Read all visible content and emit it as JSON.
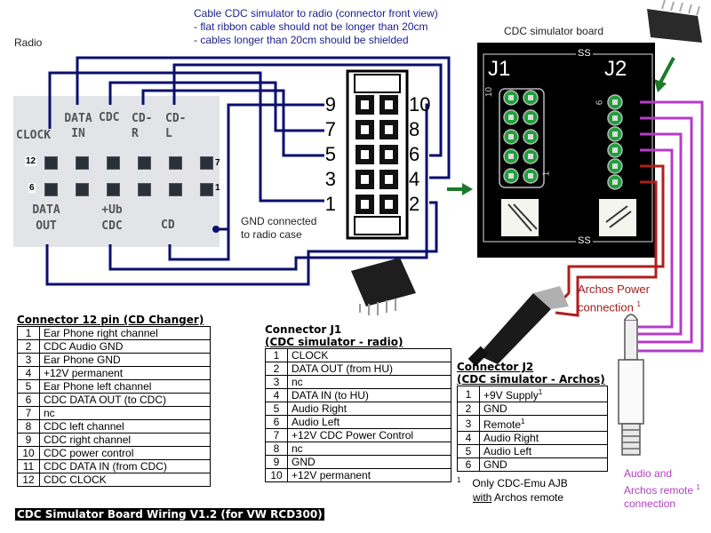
{
  "labels": {
    "radio": "Radio",
    "cable_note_lines": [
      "Cable CDC simulator to radio (connector front view)",
      "- flat ribbon cable should not be longer than 20cm",
      "- cables longer than 20cm should be shielded"
    ],
    "board_title": "CDC simulator board",
    "gnd_note_lines": [
      "GND connected",
      "to radio case"
    ],
    "archos_power_lines": [
      "Archos Power",
      "connection"
    ],
    "audio_remote_lines": [
      "Audio and",
      "Archos remote",
      "connection"
    ],
    "footnote_mark": "1"
  },
  "radio_connector": {
    "top_labels": [
      "CLOCK",
      "DATA IN",
      "CDC",
      "CD-R",
      "CD-L"
    ],
    "bottom_labels": [
      "DATA OUT",
      "+Ub CDC",
      "CD"
    ],
    "row1_left": "12",
    "row1_right": "7",
    "row2_left": "6",
    "row2_right": "1"
  },
  "cable_connector": {
    "left_pins": [
      "9",
      "7",
      "5",
      "3",
      "1"
    ],
    "right_pins": [
      "10",
      "8",
      "6",
      "4",
      "2"
    ]
  },
  "board": {
    "j1_label": "J1",
    "j2_label": "J2",
    "j1_pin_top": "10",
    "j1_pin_bottom": "1",
    "j2_pin_top": "6",
    "silk_mark": "SS"
  },
  "colors": {
    "wire_radio": "#0a0f6e",
    "wire_audio": "#b43cc8",
    "wire_power": "#b01e1e",
    "arrow": "#1a7a2a",
    "pad_green": "#1fa03a",
    "board_bg": "#000000"
  },
  "table_cdc": {
    "title": "Connector 12 pin (CD Changer)",
    "rows": [
      {
        "pin": "1",
        "desc": "Ear Phone right channel"
      },
      {
        "pin": "2",
        "desc": "CDC Audio GND"
      },
      {
        "pin": "3",
        "desc": "Ear Phone GND"
      },
      {
        "pin": "4",
        "desc": "+12V permanent"
      },
      {
        "pin": "5",
        "desc": "Ear Phone left channel"
      },
      {
        "pin": "6",
        "desc": "CDC DATA OUT (to CDC)"
      },
      {
        "pin": "7",
        "desc": "nc"
      },
      {
        "pin": "8",
        "desc": "CDC left channel"
      },
      {
        "pin": "9",
        "desc": "CDC right channel"
      },
      {
        "pin": "10",
        "desc": "CDC power control"
      },
      {
        "pin": "11",
        "desc": "CDC DATA IN (from CDC)"
      },
      {
        "pin": "12",
        "desc": "CDC CLOCK"
      }
    ]
  },
  "table_j1": {
    "title_line1": "Connector J1",
    "title_line2": "(CDC simulator - radio)",
    "rows": [
      {
        "pin": "1",
        "desc": "CLOCK"
      },
      {
        "pin": "2",
        "desc": "DATA OUT (from HU)"
      },
      {
        "pin": "3",
        "desc": "nc"
      },
      {
        "pin": "4",
        "desc": "DATA IN (to HU)"
      },
      {
        "pin": "5",
        "desc": "Audio Right"
      },
      {
        "pin": "6",
        "desc": "Audio Left"
      },
      {
        "pin": "7",
        "desc": "+12V CDC Power Control"
      },
      {
        "pin": "8",
        "desc": "nc"
      },
      {
        "pin": "9",
        "desc": "GND"
      },
      {
        "pin": "10",
        "desc": "+12V permanent"
      }
    ]
  },
  "table_j2": {
    "title_line1": "Connector J2",
    "title_line2": "(CDC simulator - Archos)",
    "rows": [
      {
        "pin": "1",
        "desc": "+9V Supply",
        "sup": "1"
      },
      {
        "pin": "2",
        "desc": "GND",
        "sup": ""
      },
      {
        "pin": "3",
        "desc": "Remote",
        "sup": "1"
      },
      {
        "pin": "4",
        "desc": "Audio Right",
        "sup": ""
      },
      {
        "pin": "5",
        "desc": "Audio Left",
        "sup": ""
      },
      {
        "pin": "6",
        "desc": "GND",
        "sup": ""
      }
    ],
    "footnote_line1": "Only CDC-Emu AJB",
    "footnote_with": "with",
    "footnote_rest": " Archos remote"
  },
  "footer": "CDC Simulator Board Wiring V1.2 (for VW RCD300)"
}
